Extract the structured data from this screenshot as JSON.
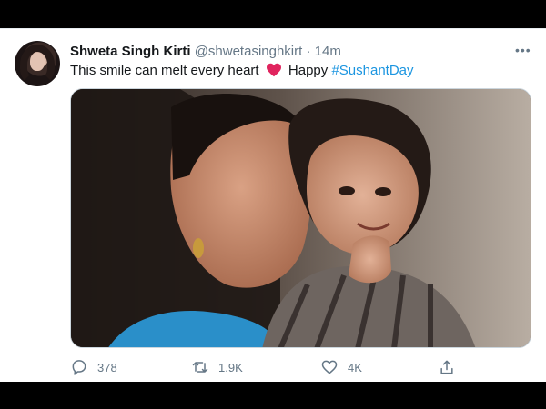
{
  "tweet": {
    "author_name": "Shweta Singh Kirti",
    "author_handle": "@shwetasinghkirt",
    "separator": "·",
    "timestamp": "14m",
    "text_before": "This smile can melt every heart",
    "text_after": " Happy ",
    "hashtag": "#SushantDay",
    "more_glyph": "•••"
  },
  "actions": {
    "reply_count": "378",
    "retweet_count": "1.9K",
    "like_count": "4K"
  },
  "icons": {
    "reply": "reply-icon",
    "retweet": "retweet-icon",
    "like": "like-icon",
    "share": "share-icon",
    "more": "more-options-icon",
    "emoji": "red-heart-emoji"
  },
  "colors": {
    "text_primary": "#14171a",
    "text_secondary": "#657786",
    "link": "#1b95e0",
    "heart": "#e0245e",
    "background": "#ffffff",
    "letterbox": "#000000"
  }
}
